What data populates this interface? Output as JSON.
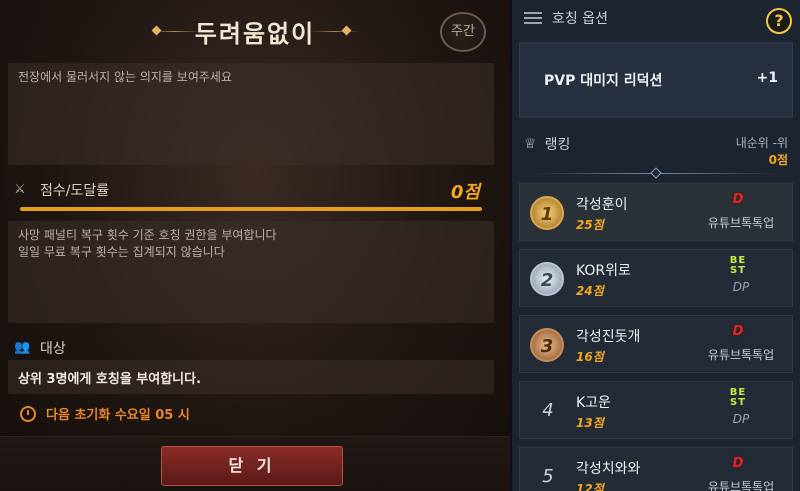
{
  "left": {
    "title": "두려움없이",
    "weekly_badge": "주간",
    "description": "전장에서 물러서지 않는 의지를 보여주세요",
    "score_label": "점수/도달률",
    "score_value": "0점",
    "score_progress": 1.0,
    "condition_line1": "사망 패널티 복구 횟수 기준 호칭 권한을 부여합니다",
    "condition_line2": "일일 무료 복구 횟수는 집계되지 않습니다",
    "target_label": "대상",
    "target_text": "상위 3명에게 호칭을 부여합니다.",
    "reset_text": "다음 초기화 수요일 05 시",
    "close_button": "닫 기"
  },
  "right": {
    "option_header": "호칭 옵션",
    "help": "?",
    "option_name": "PVP 대미지 리덕션",
    "option_value": "+1",
    "ranking_header": "랭킹",
    "my_rank_label": "내순위 -위",
    "my_rank_score": "0점",
    "rows": [
      {
        "rank": "1",
        "name": "각성훈이",
        "score": "25점",
        "guild_logo": "D",
        "guild": "유튜브톡톡업"
      },
      {
        "rank": "2",
        "name": "KOR위로",
        "score": "24점",
        "guild_logo": "BE ST",
        "guild": "DP"
      },
      {
        "rank": "3",
        "name": "각성진돗개",
        "score": "16점",
        "guild_logo": "D",
        "guild": "유튜브톡톡업"
      },
      {
        "rank": "4",
        "name": "K고운",
        "score": "13점",
        "guild_logo": "BE ST",
        "guild": "DP"
      },
      {
        "rank": "5",
        "name": "각성치와와",
        "score": "12점",
        "guild_logo": "D",
        "guild": "유튜브톡톡업"
      }
    ]
  }
}
